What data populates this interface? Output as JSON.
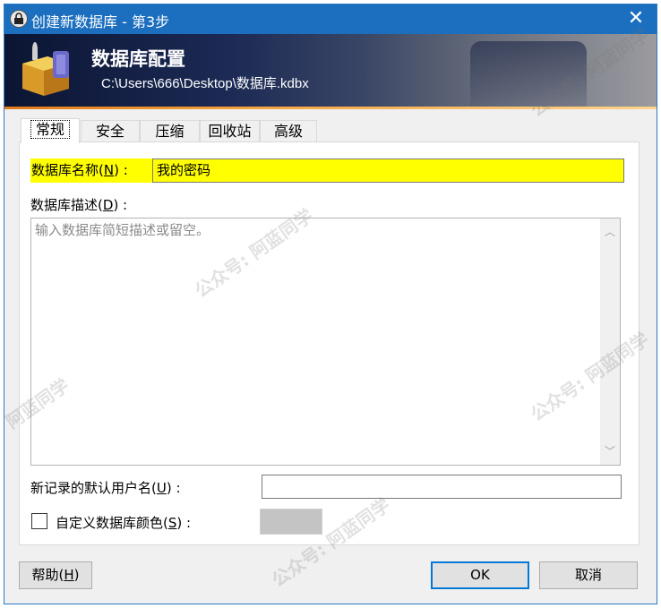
{
  "window": {
    "title": "创建新数据库 - 第3步",
    "close_glyph": "✕"
  },
  "banner": {
    "heading": "数据库配置",
    "path": "C:\\Users\\666\\Desktop\\数据库.kdbx"
  },
  "tabs": [
    {
      "label": "常规",
      "active": true
    },
    {
      "label": "安全",
      "active": false
    },
    {
      "label": "压缩",
      "active": false
    },
    {
      "label": "回收站",
      "active": false
    },
    {
      "label": "高级",
      "active": false
    }
  ],
  "general": {
    "name_label": "数据库名称",
    "name_hotkey": "N",
    "name_value": "我的密码",
    "desc_label": "数据库描述",
    "desc_hotkey": "D",
    "desc_placeholder": "输入数据库简短描述或留空。",
    "user_label": "新记录的默认用户名",
    "user_hotkey": "U",
    "user_value": "",
    "color_label": "自定义数据库颜色",
    "color_hotkey": "S",
    "color_checked": false,
    "color_swatch": "#c4c4c4"
  },
  "buttons": {
    "help_label": "帮助",
    "help_hotkey": "H",
    "ok_label": "OK",
    "cancel_label": "取消"
  },
  "watermark": {
    "text1": "公众号: 阿蓝同学",
    "text2": "阿蓝同学"
  },
  "colors": {
    "titlebar": "#1c6fbf",
    "highlight": "#ffff00",
    "accent_line": "#f5a542",
    "default_button_border": "#0078d7"
  },
  "icons": {
    "app": "keepass-lock-icon",
    "banner": "database-padlock-icon",
    "close": "close-icon",
    "scroll_up": "chevron-up-icon",
    "scroll_down": "chevron-down-icon"
  }
}
